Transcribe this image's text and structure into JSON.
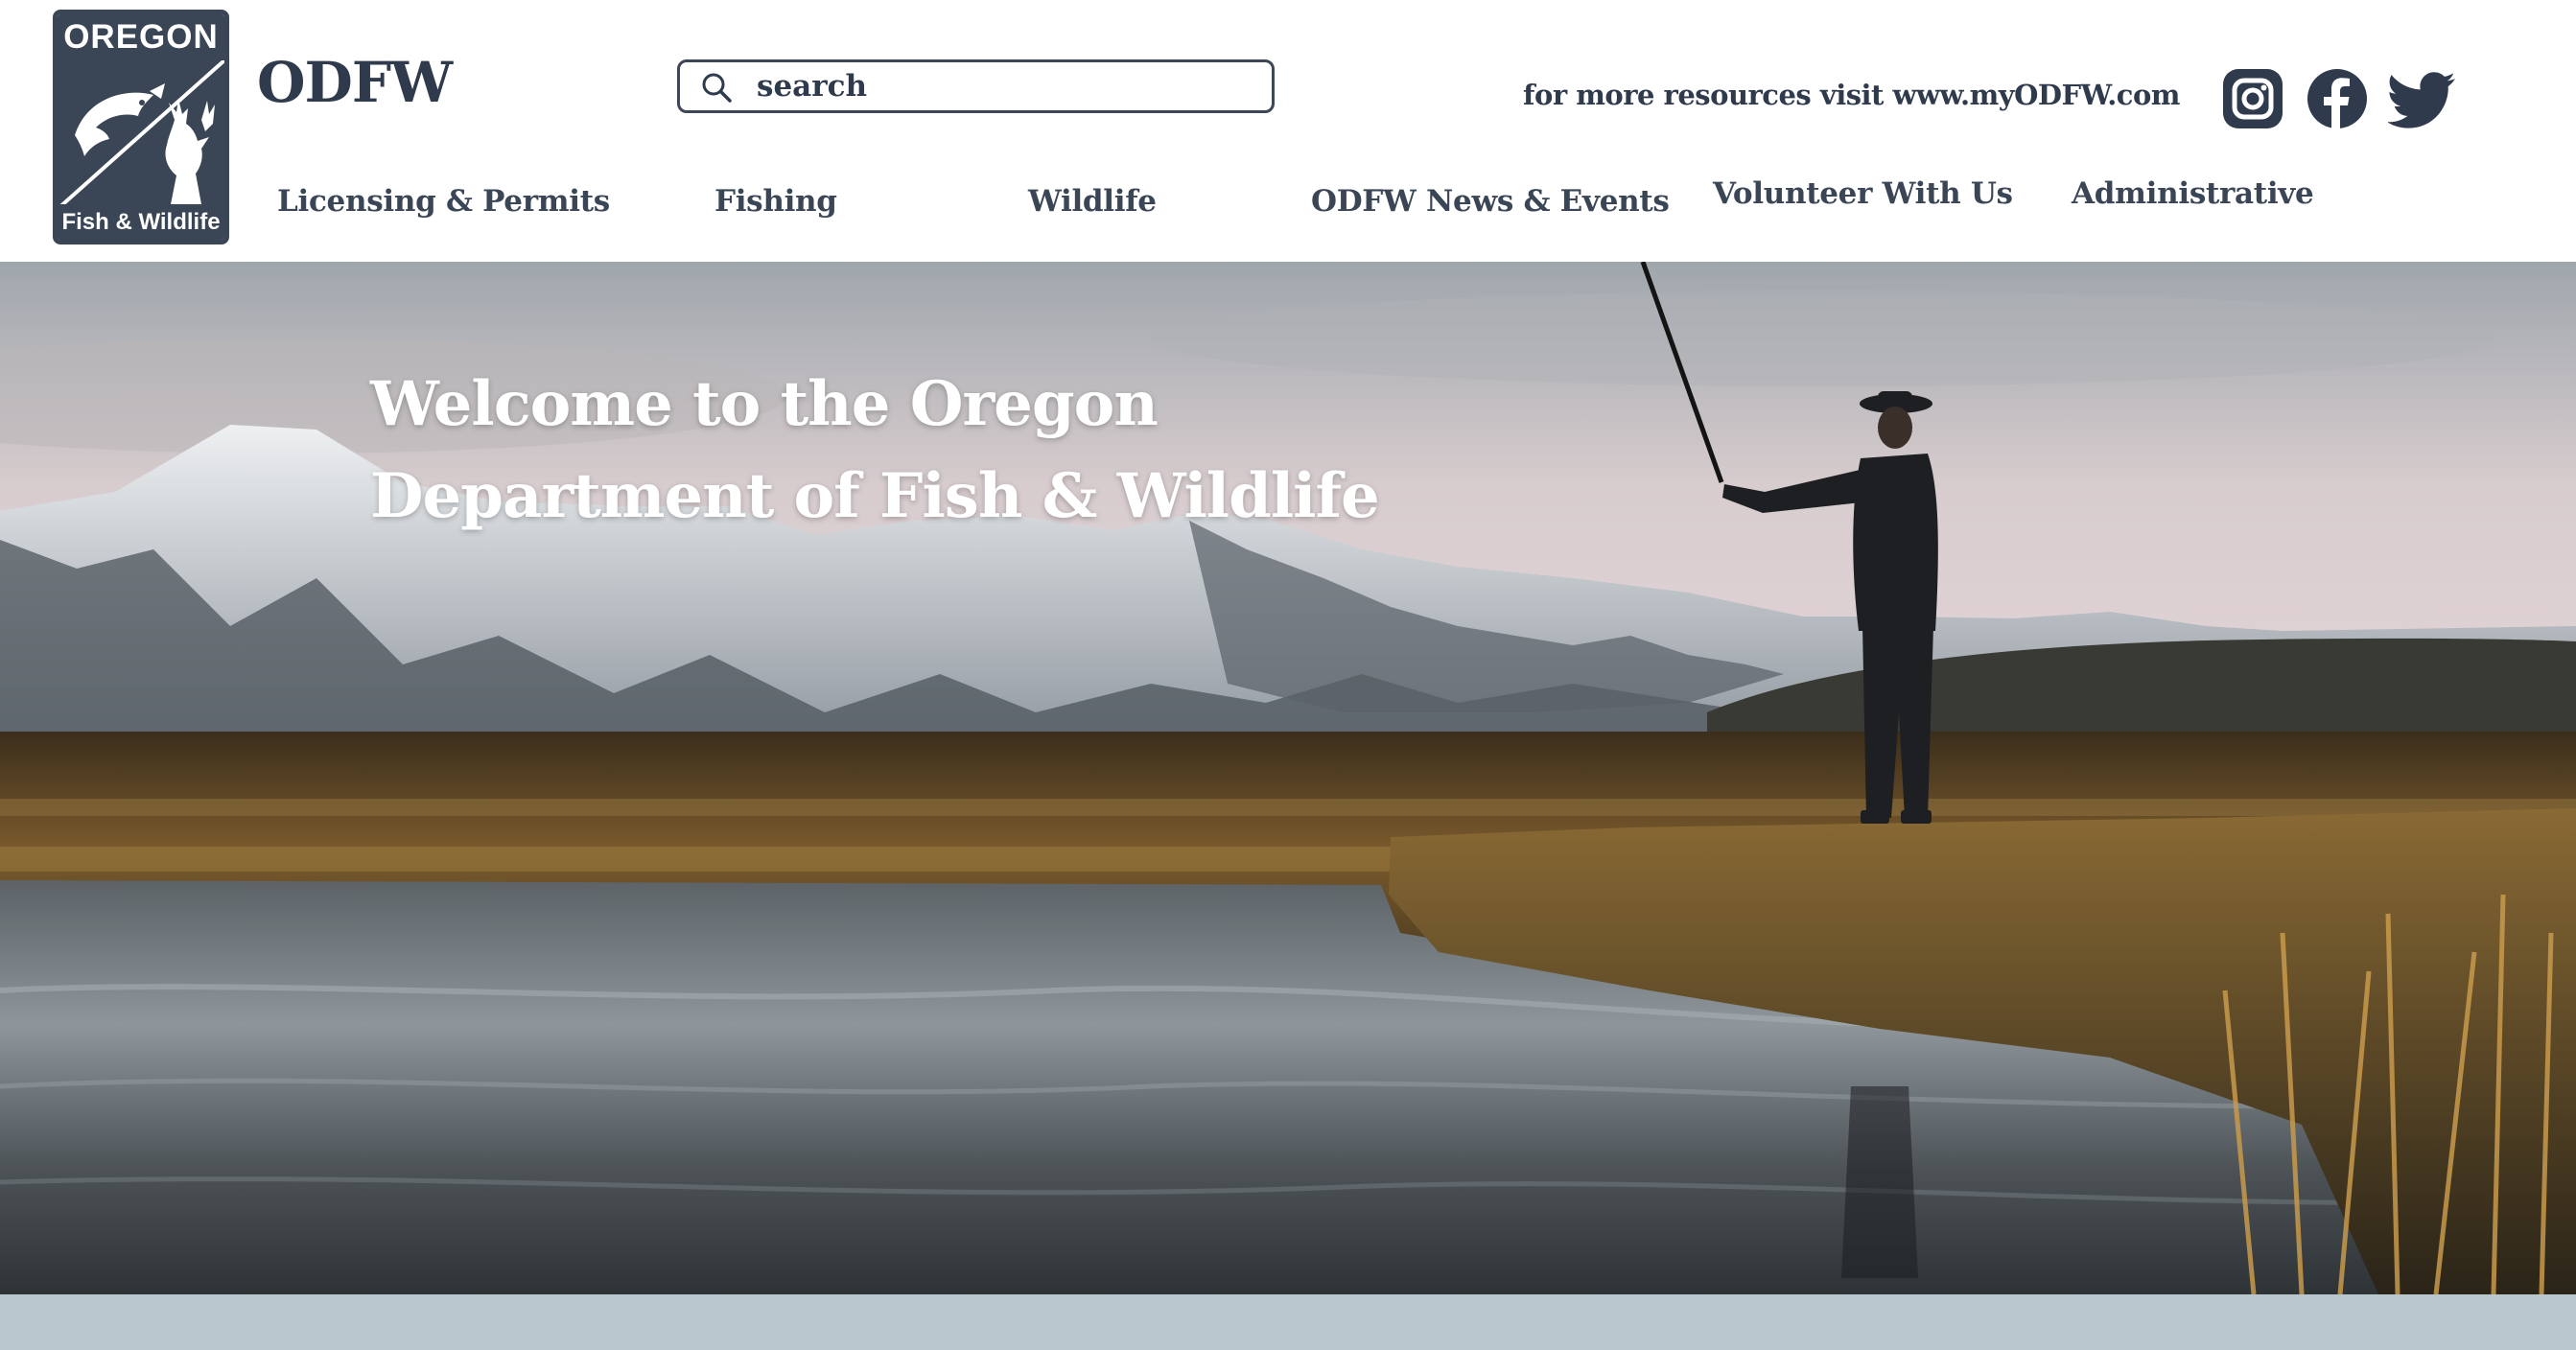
{
  "header": {
    "logo": {
      "top_text": "OREGON",
      "bottom_text": "Fish & Wildlife"
    },
    "site_name": "ODFW",
    "search": {
      "placeholder": "search",
      "value": ""
    },
    "resources_text": "for more resources visit www.myODFW.com",
    "social": [
      "instagram-icon",
      "facebook-icon",
      "twitter-icon"
    ]
  },
  "nav": {
    "items": [
      {
        "label": "Licensing & Permits"
      },
      {
        "label": "Fishing"
      },
      {
        "label": "Wildlife"
      },
      {
        "label": "ODFW News & Events"
      },
      {
        "label": "Volunteer With Us"
      },
      {
        "label": "Administrative"
      }
    ]
  },
  "hero": {
    "title": "Welcome to the Oregon Department of Fish & Wildlife"
  },
  "colors": {
    "brand": "#3a4555",
    "text": "#2f3b4c",
    "footer_band": "#b9c7cf"
  }
}
